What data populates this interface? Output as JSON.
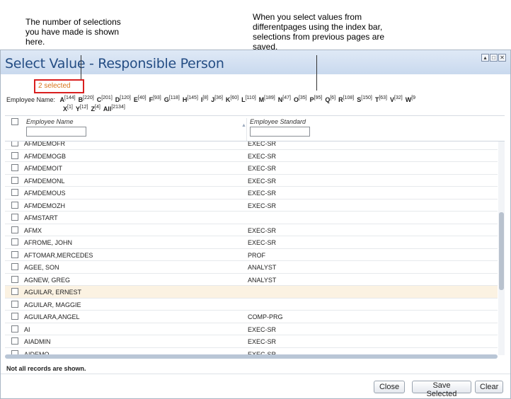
{
  "callouts": {
    "selections": "The number of selections you have made is shown here.",
    "pages": "When you select values from differentpages using the index bar, selections from previous pages are saved."
  },
  "dialog": {
    "title": "Select Value - Responsible Person",
    "window_buttons": [
      "▴",
      "□",
      "✕"
    ],
    "selected_label": "2 selected"
  },
  "index_bar": {
    "label": "Employee Name:",
    "row1": [
      {
        "letter": "A",
        "count": "[144]"
      },
      {
        "letter": "B",
        "count": "[220]"
      },
      {
        "letter": "C",
        "count": "[201]"
      },
      {
        "letter": "D",
        "count": "[120]"
      },
      {
        "letter": "E",
        "count": "[40]"
      },
      {
        "letter": "F",
        "count": "[93]"
      },
      {
        "letter": "G",
        "count": "[118]"
      },
      {
        "letter": "H",
        "count": "[145]"
      },
      {
        "letter": "I",
        "count": "[8]"
      },
      {
        "letter": "J",
        "count": "[36]"
      },
      {
        "letter": "K",
        "count": "[60]"
      },
      {
        "letter": "L",
        "count": "[110]"
      },
      {
        "letter": "M",
        "count": "[189]"
      },
      {
        "letter": "N",
        "count": "[47]"
      },
      {
        "letter": "O",
        "count": "[35]"
      },
      {
        "letter": "P",
        "count": "[95]"
      },
      {
        "letter": "Q",
        "count": "[6]"
      },
      {
        "letter": "R",
        "count": "[108]"
      },
      {
        "letter": "S",
        "count": "[150]"
      },
      {
        "letter": "T",
        "count": "[63]"
      },
      {
        "letter": "V",
        "count": "[32]"
      },
      {
        "letter": "W",
        "count": "[9"
      }
    ],
    "row2": [
      {
        "letter": "X",
        "count": "[1]"
      },
      {
        "letter": "Y",
        "count": "[12]"
      },
      {
        "letter": "Z",
        "count": "[4]"
      },
      {
        "letter": "All",
        "count": "[2134]"
      }
    ]
  },
  "grid": {
    "columns": {
      "name": "Employee Name",
      "standard": "Employee Standard"
    },
    "rows": [
      {
        "name": "AFMDEMOFR",
        "standard": "EXEC-SR"
      },
      {
        "name": "AFMDEMOGB",
        "standard": "EXEC-SR"
      },
      {
        "name": "AFMDEMOIT",
        "standard": "EXEC-SR"
      },
      {
        "name": "AFMDEMONL",
        "standard": "EXEC-SR"
      },
      {
        "name": "AFMDEMOUS",
        "standard": "EXEC-SR"
      },
      {
        "name": "AFMDEMOZH",
        "standard": "EXEC-SR"
      },
      {
        "name": "AFMSTART",
        "standard": ""
      },
      {
        "name": "AFMX",
        "standard": "EXEC-SR"
      },
      {
        "name": "AFROME, JOHN",
        "standard": "EXEC-SR"
      },
      {
        "name": "AFTOMAR,MERCEDES",
        "standard": "PROF"
      },
      {
        "name": "AGEE, SON",
        "standard": "ANALYST"
      },
      {
        "name": "AGNEW, GREG",
        "standard": "ANALYST"
      },
      {
        "name": "AGUILAR, ERNEST",
        "standard": "",
        "highlight": true
      },
      {
        "name": "AGUILAR, MAGGIE",
        "standard": ""
      },
      {
        "name": "AGUILARA,ANGEL",
        "standard": "COMP-PRG"
      },
      {
        "name": "AI",
        "standard": "EXEC-SR"
      },
      {
        "name": "AIADMIN",
        "standard": "EXEC-SR"
      },
      {
        "name": "AIDEMO",
        "standard": "EXEC-SR"
      }
    ]
  },
  "footer": {
    "note": "Not all records are shown.",
    "close_label": "Close",
    "save_label": "Save Selected",
    "clear_label": "Clear"
  },
  "colors": {
    "title": "#244d84",
    "badge_border": "#d91f1f",
    "badge_text": "#d9741a",
    "row_highlight": "#fbf2e2"
  }
}
